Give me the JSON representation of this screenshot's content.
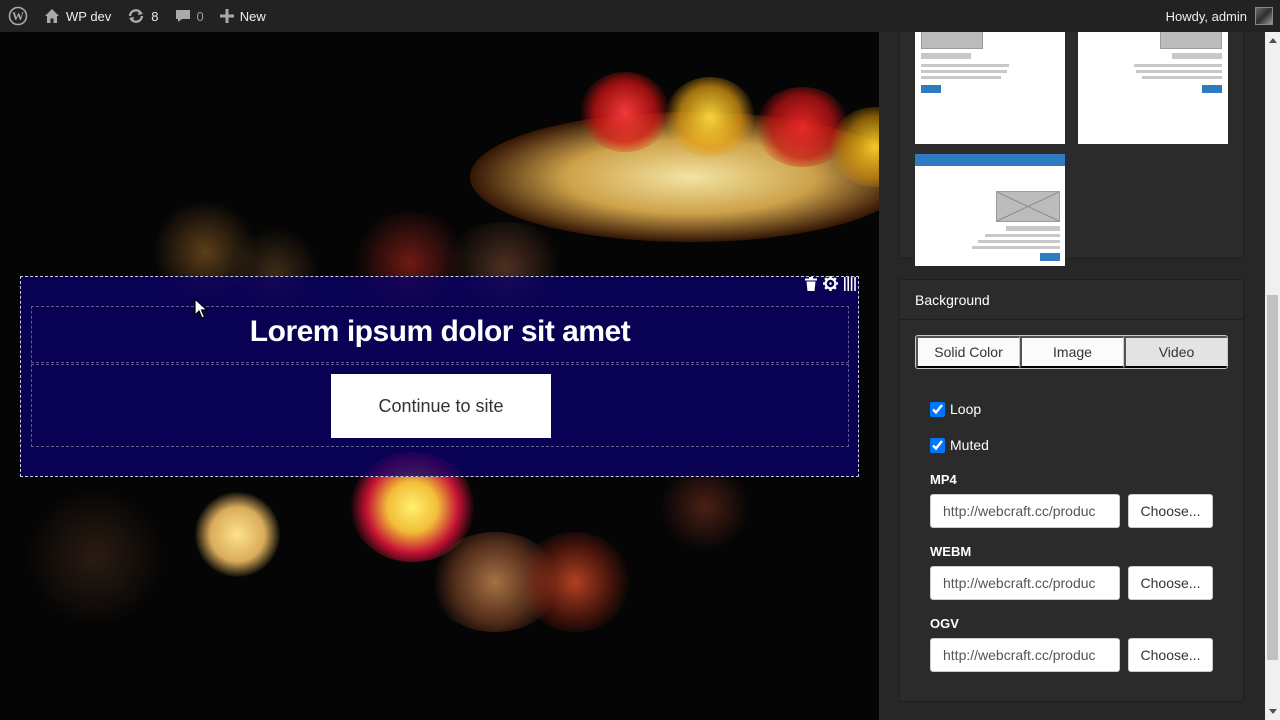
{
  "admin_bar": {
    "site_name": "WP dev",
    "updates_count": "8",
    "comments_count": "0",
    "new_label": "New",
    "greeting": "Howdy, admin"
  },
  "canvas": {
    "section_tools": [
      "trash-icon",
      "gear-icon",
      "drag-handle-icon"
    ],
    "heading": "Lorem ipsum dolor sit amet",
    "button_label": "Continue to site",
    "overlay_color": "#0a0069"
  },
  "layouts_panel": {
    "accent_color": "#2e7bbf"
  },
  "background_panel": {
    "title": "Background",
    "tabs": [
      {
        "label": "Solid Color",
        "active": false
      },
      {
        "label": "Image",
        "active": false
      },
      {
        "label": "Video",
        "active": true
      }
    ],
    "loop_label": "Loop",
    "loop_checked": true,
    "muted_label": "Muted",
    "muted_checked": true,
    "sources": [
      {
        "label": "MP4",
        "value": "http://webcraft.cc/produc",
        "button": "Choose..."
      },
      {
        "label": "WEBM",
        "value": "http://webcraft.cc/produc",
        "button": "Choose..."
      },
      {
        "label": "OGV",
        "value": "http://webcraft.cc/produc",
        "button": "Choose..."
      }
    ]
  }
}
